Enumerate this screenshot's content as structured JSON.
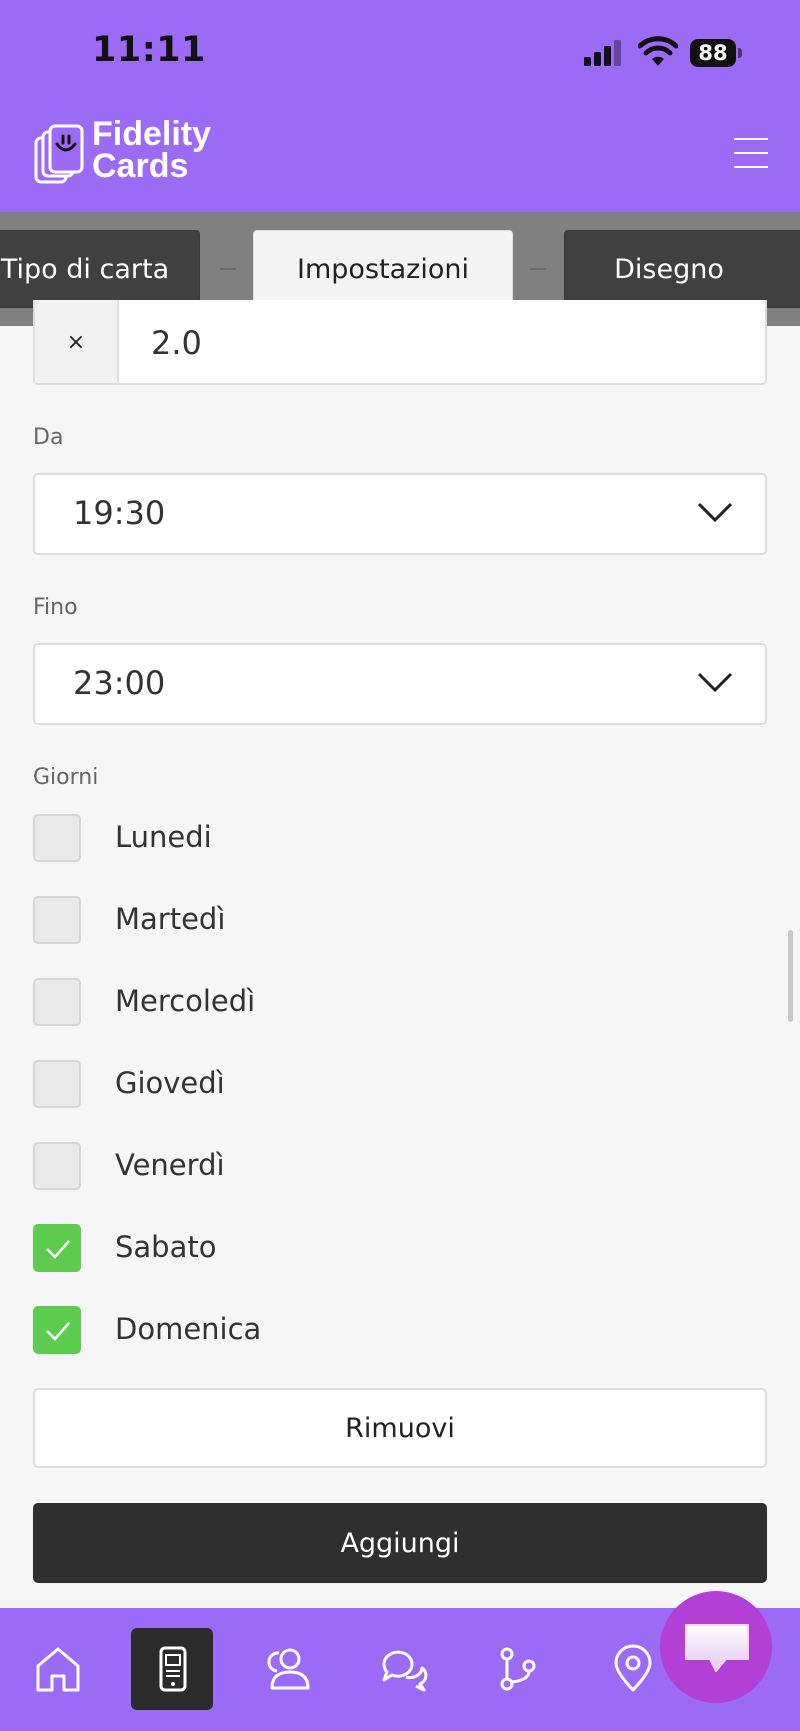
{
  "status_bar": {
    "time": "11:11",
    "battery": "88"
  },
  "header": {
    "logo_line1": "Fidelity",
    "logo_line2": "Cards"
  },
  "tabs": [
    {
      "label": "Tipo di carta",
      "state": "inactive"
    },
    {
      "label": "Impostazioni",
      "state": "active"
    },
    {
      "label": "Disegno",
      "state": "inactive"
    }
  ],
  "form": {
    "multiplier": {
      "prefix": "×",
      "value": "2.0"
    },
    "from": {
      "label": "Da",
      "value": "19:30"
    },
    "until": {
      "label": "Fino",
      "value": "23:00"
    },
    "days": {
      "label": "Giorni",
      "items": [
        {
          "label": "Lunedi",
          "checked": false
        },
        {
          "label": "Martedì",
          "checked": false
        },
        {
          "label": "Mercoledì",
          "checked": false
        },
        {
          "label": "Giovedì",
          "checked": false
        },
        {
          "label": "Venerdì",
          "checked": false
        },
        {
          "label": "Sabato",
          "checked": true
        },
        {
          "label": "Domenica",
          "checked": true
        }
      ]
    },
    "remove_label": "Rimuovi",
    "add_label": "Aggiungi"
  },
  "bottom_nav": [
    {
      "icon": "home-icon",
      "active": false
    },
    {
      "icon": "phone-card-icon",
      "active": true
    },
    {
      "icon": "users-icon",
      "active": false
    },
    {
      "icon": "chat-bubbles-icon",
      "active": false
    },
    {
      "icon": "branch-icon",
      "active": false
    },
    {
      "icon": "location-pin-icon",
      "active": false
    }
  ],
  "colors": {
    "brand": "#9b6bf5",
    "check_on": "#5ccb4e",
    "fab": "#b23fd6"
  }
}
